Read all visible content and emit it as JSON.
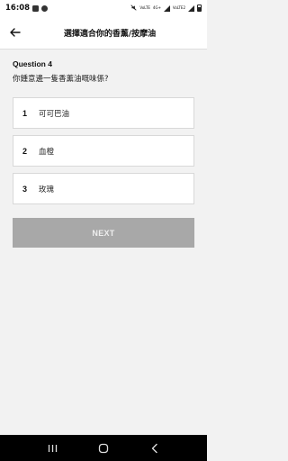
{
  "status_bar": {
    "time": "16:08",
    "net1": "VoLTE",
    "net2": "4G+",
    "net3": "LTE1",
    "net4": "VoLTE2",
    "net5": "LTE2"
  },
  "header": {
    "title": "選擇適合你的香薰/按摩油",
    "back_icon": "arrow-left-icon"
  },
  "question": {
    "number": "Question 4",
    "text": "你鍾意邊一隻香薰油嘅味係?"
  },
  "options": [
    {
      "num": "1",
      "label": "可可巴油"
    },
    {
      "num": "2",
      "label": "血橙"
    },
    {
      "num": "3",
      "label": "玫瑰"
    }
  ],
  "next_button": {
    "label": "NEXT"
  },
  "nav_bar": {
    "recents_icon": "recents-icon",
    "home_icon": "home-icon",
    "back_icon": "back-nav-icon"
  },
  "colors": {
    "background": "#f2f2f2",
    "card": "#ffffff",
    "button_disabled": "#a8a8a8",
    "nav_bar": "#000000"
  }
}
